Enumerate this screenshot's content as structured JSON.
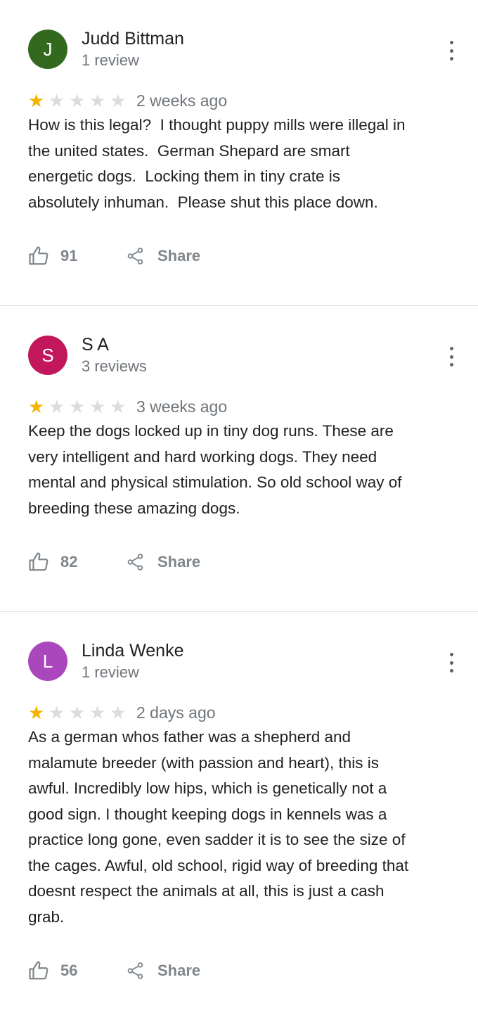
{
  "reviews": [
    {
      "initial": "J",
      "avatar_color": "#33691e",
      "author": "Judd Bittman",
      "review_count": "1 review",
      "rating": 1,
      "date": "2 weeks ago",
      "text": "How is this legal?  I thought puppy mills were illegal in\nthe united states.  German Shepard are smart\nenergetic dogs.  Locking them in tiny crate is\nabsolutely inhuman.  Please shut this place down.",
      "likes": "91",
      "share_label": "Share"
    },
    {
      "initial": "S",
      "avatar_color": "#c2185b",
      "author": "S A",
      "review_count": "3 reviews",
      "rating": 1,
      "date": "3 weeks ago",
      "text": "Keep the dogs locked up in tiny dog runs. These are\nvery intelligent and hard working dogs. They need\nmental and physical stimulation. So old school way of\nbreeding these amazing dogs.",
      "likes": "82",
      "share_label": "Share"
    },
    {
      "initial": "L",
      "avatar_color": "#ab47bc",
      "author": "Linda Wenke",
      "review_count": "1 review",
      "rating": 1,
      "date": "2 days ago",
      "text": "As a german whos father was a shepherd and\nmalamute breeder (with passion and heart), this is\nawful. Incredibly low hips, which is genetically not a\ngood sign. I thought keeping dogs in kennels was a\npractice long gone, even sadder it is to see the size of\nthe cages. Awful, old school, rigid way of breeding that\ndoesnt respect the animals at all, this is just a cash\ngrab.",
      "likes": "56",
      "share_label": "Share"
    }
  ]
}
